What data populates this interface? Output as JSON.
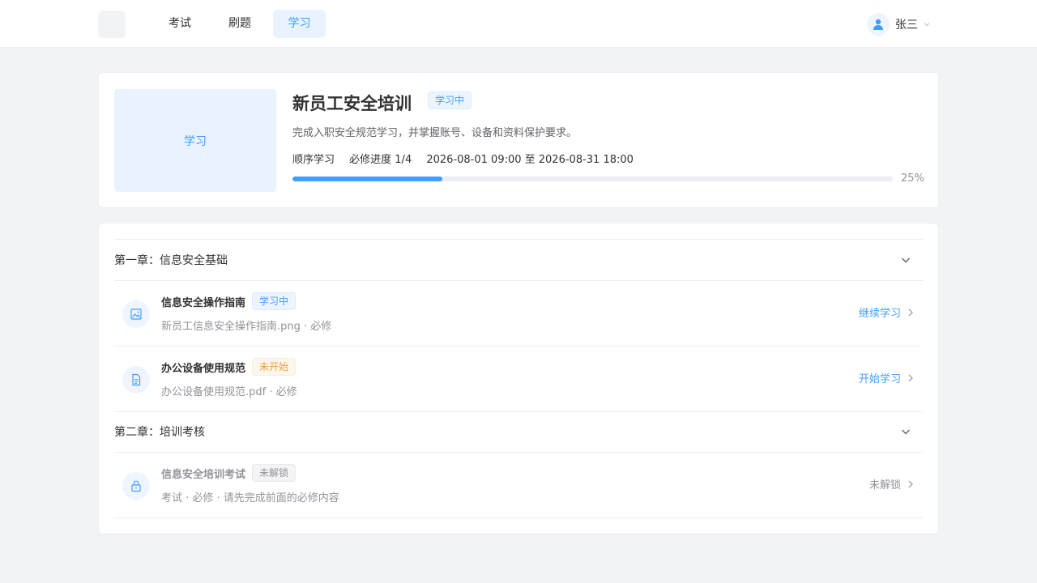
{
  "header": {
    "nav": [
      {
        "label": "考试"
      },
      {
        "label": "刷题"
      },
      {
        "label": "学习"
      }
    ],
    "user": {
      "name": "张三"
    }
  },
  "course": {
    "cover_label": "学习",
    "title": "新员工安全培训",
    "status": "学习中",
    "description": "完成入职安全规范学习，并掌握账号、设备和资料保护要求。",
    "mode": "顺序学习",
    "required_progress": "必修进度 1/4",
    "period": "2026-08-01 09:00 至 2026-08-31 18:00",
    "progress_percent": 25,
    "progress_text": "25%"
  },
  "chapters": [
    {
      "title": "第一章：信息安全基础",
      "lessons": [
        {
          "title": "信息安全操作指南",
          "status": "学习中",
          "subtitle": "新员工信息安全操作指南.png · 必修",
          "action": "继续学习",
          "icon": "image-icon"
        },
        {
          "title": "办公设备使用规范",
          "status": "未开始",
          "subtitle": "办公设备使用规范.pdf · 必修",
          "action": "开始学习",
          "icon": "document-icon"
        }
      ]
    },
    {
      "title": "第二章：培训考核",
      "lessons": [
        {
          "title": "信息安全培训考试",
          "status": "未解锁",
          "subtitle": "考试 · 必修 · 请先完成前面的必修内容",
          "action": "未解锁",
          "icon": "lock-icon"
        }
      ]
    }
  ],
  "colors": {
    "primary": "#409eff",
    "warning": "#e6a23c",
    "muted": "#909399",
    "page_bg": "#f2f3f5"
  }
}
